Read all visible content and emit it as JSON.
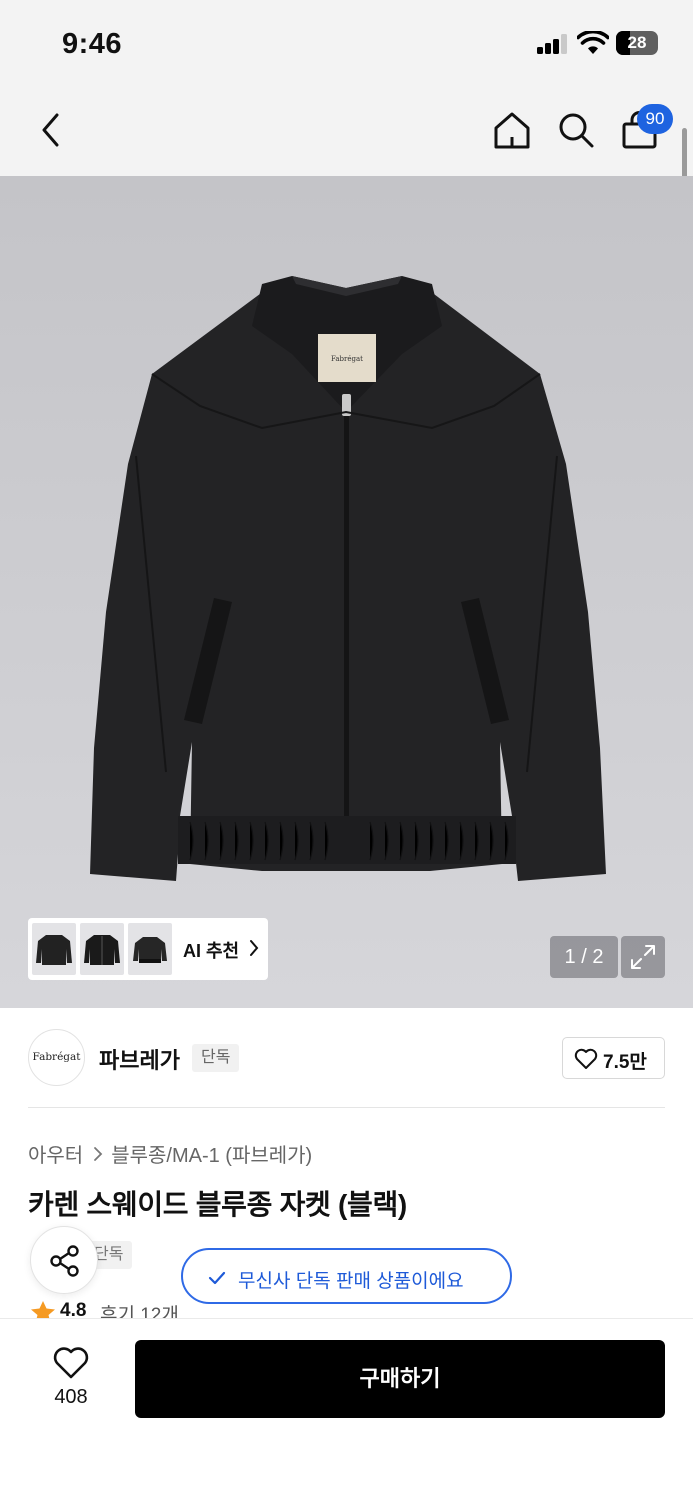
{
  "status_bar": {
    "time": "9:46",
    "battery": "28"
  },
  "nav": {
    "cart_count": "90",
    "icons": [
      "chevron-left-icon",
      "home-icon",
      "search-icon",
      "shopping-bag-icon"
    ]
  },
  "gallery": {
    "ai_recommend_label": "AI 추천",
    "page_indicator": "1 / 2",
    "product_label": "Fabrégat"
  },
  "brand": {
    "logo_text": "Fabrégat",
    "name": "파브레가",
    "tag": "단독",
    "likes": "7.5만"
  },
  "product": {
    "breadcrumb": [
      "아우터",
      "블루종/MA-1 (파브레가)"
    ],
    "title": "카렌 스웨이드 블루종 자켓 (블랙)",
    "tag": "단독",
    "rating": "4.8",
    "reviews": "후기 12개"
  },
  "toast": {
    "text": "무신사 단독 판매 상품이에요"
  },
  "bottom": {
    "wish_count": "408",
    "buy_label": "구매하기"
  },
  "colors": {
    "accent": "#1e63e0",
    "button": "#000000",
    "star": "#f59a23"
  }
}
